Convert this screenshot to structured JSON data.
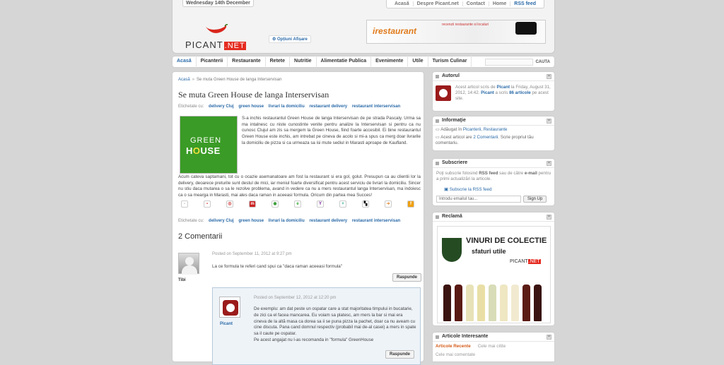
{
  "header": {
    "date": "Wednesday 14th December",
    "top_links": [
      "Acasă",
      "Despre Picant.net",
      "Contact",
      "Home",
      "RSS feed"
    ],
    "logo_text": "PICANT",
    "logo_suffix": ".NET",
    "options": "Opțiuni Afișare",
    "banner": {
      "brand": "irestaurant",
      "tagline": "recenzii restaurante si localuri"
    }
  },
  "nav": {
    "items": [
      "Acasă",
      "Picanterii",
      "Restaurante",
      "Retete",
      "Nutritie",
      "Alimentatie Publica",
      "Evenimente",
      "Utile",
      "Turism Culinar"
    ],
    "search_button": "CAUTA"
  },
  "post": {
    "breadcrumb": [
      "Acasă",
      "Se muta Green House de langa Interservisan"
    ],
    "title": "Se muta Green House de langa Interservisan",
    "tags_label": "Etichetate cu:",
    "tags": [
      "delivery Cluj",
      "green house",
      "livrari la domiciliu",
      "restaurant delivery",
      "restaurant interservisan"
    ],
    "image": {
      "line1": "GREEN",
      "line2a": "H",
      "line2b": "O",
      "line2c": "USE"
    },
    "body_1": "S-a inchis restaurantul Green House de langa Interservisan de pe strada Pascaly. Urma sa ma intalnesc cu niste cunostinte venite pentru analize la Interservisan si pentru ca nu cunosc Clujul am zis sa mergem la Green House, fiind foarte accesibil. Ei bine restaurantul Green House este inchis, am intrebat pe cineva de acolo si mi-a spus ca merg doar livrarile la domiciliu de pizza si ca urmeaza sa isi mute sediul in Marasti aproape de Kaufland.",
    "body_2": "Acum cateva saptamani, tot cu o ocazie asemanatoare am fost la restaurant si era gol, golut. Presupun ca au clientii lor la delivery, deoarece preturile sunt destul de mici, iar meniul foarte diversificat pentru acest serviciu de livrari la domiciliu. Sincer nu stiu daca mutarea o sa le rezolve problema, avand in vedere ca nu a mers restaurantul langa Interservisan, ma indoiesc ca o sa mearga in Marasti, mai ales daca raman in aceeasi formula. Oricum din partea mea Succes!"
  },
  "comments": {
    "heading": "2 Comentarii",
    "items": [
      {
        "author": "Tibi",
        "meta": "Posted on September 11, 2012 at 9:27 pm",
        "text": "La ce formula te referi cand spui ca \"daca raman aceeasi formula\"",
        "reply": "Raspunde"
      },
      {
        "author": "Picant",
        "meta": "Posted on September 12, 2012 at 12:20 pm",
        "text": "De exemplu: am dat peste un ospatar care a stat majoritatea timpului in bucatarie, de zici ca el facea mancarea. Eu voiam sa platesc, am mers la bar si mai era cineva de la altă masa ca dorea sa ii se puna pizza la pachet, doar ca nu aveam cu cine discuta. Pana cand domnul respectiv (probabil mai de-al casei) a mers in spate sa il caute pe ospatar.",
        "text2": "Pe acest angajat nu l-as recomanda in \"formula\" GreenHouse",
        "reply": "Raspunde"
      }
    ]
  },
  "sidebar": {
    "autor": {
      "title": "Autorul",
      "text_a": "Acest articol scris de",
      "name": "Picant",
      "text_b": "la Friday, August 31, 2012, 14:42.",
      "name2": "Picant",
      "text_c": "a scris",
      "count": "86 articole",
      "text_d": "pe acest site."
    },
    "info": {
      "title": "Informaţie",
      "added": "Adăugat în",
      "cats": "Picanterii, Restaurante",
      "comments_a": "Acest articol are",
      "comments_link": "2 Comentarii",
      "comments_b": ". Scrie propriul tău comentariu."
    },
    "sub": {
      "title": "Subscriere",
      "text_a": "Poţi subscrie folosind",
      "rss": "RSS feed",
      "text_b": "sau de către",
      "email": "e-mail",
      "text_c": "pentru a primi actualizări la articole.",
      "link": "Subscrie la RSS feed",
      "placeholder": "Introdu emailul tau...",
      "button": "Sign Up"
    },
    "ad": {
      "title": "Reclamă",
      "line1": "VINURI DE COLECTIE",
      "line2": "sfaturi utile",
      "brand": "PICANT",
      "brand_suffix": ".NET"
    },
    "articles": {
      "title": "Articole Interesante",
      "tabs": [
        "Articole Recente",
        "Cele mai citite"
      ],
      "tab3": "Cele mai comentate"
    }
  }
}
